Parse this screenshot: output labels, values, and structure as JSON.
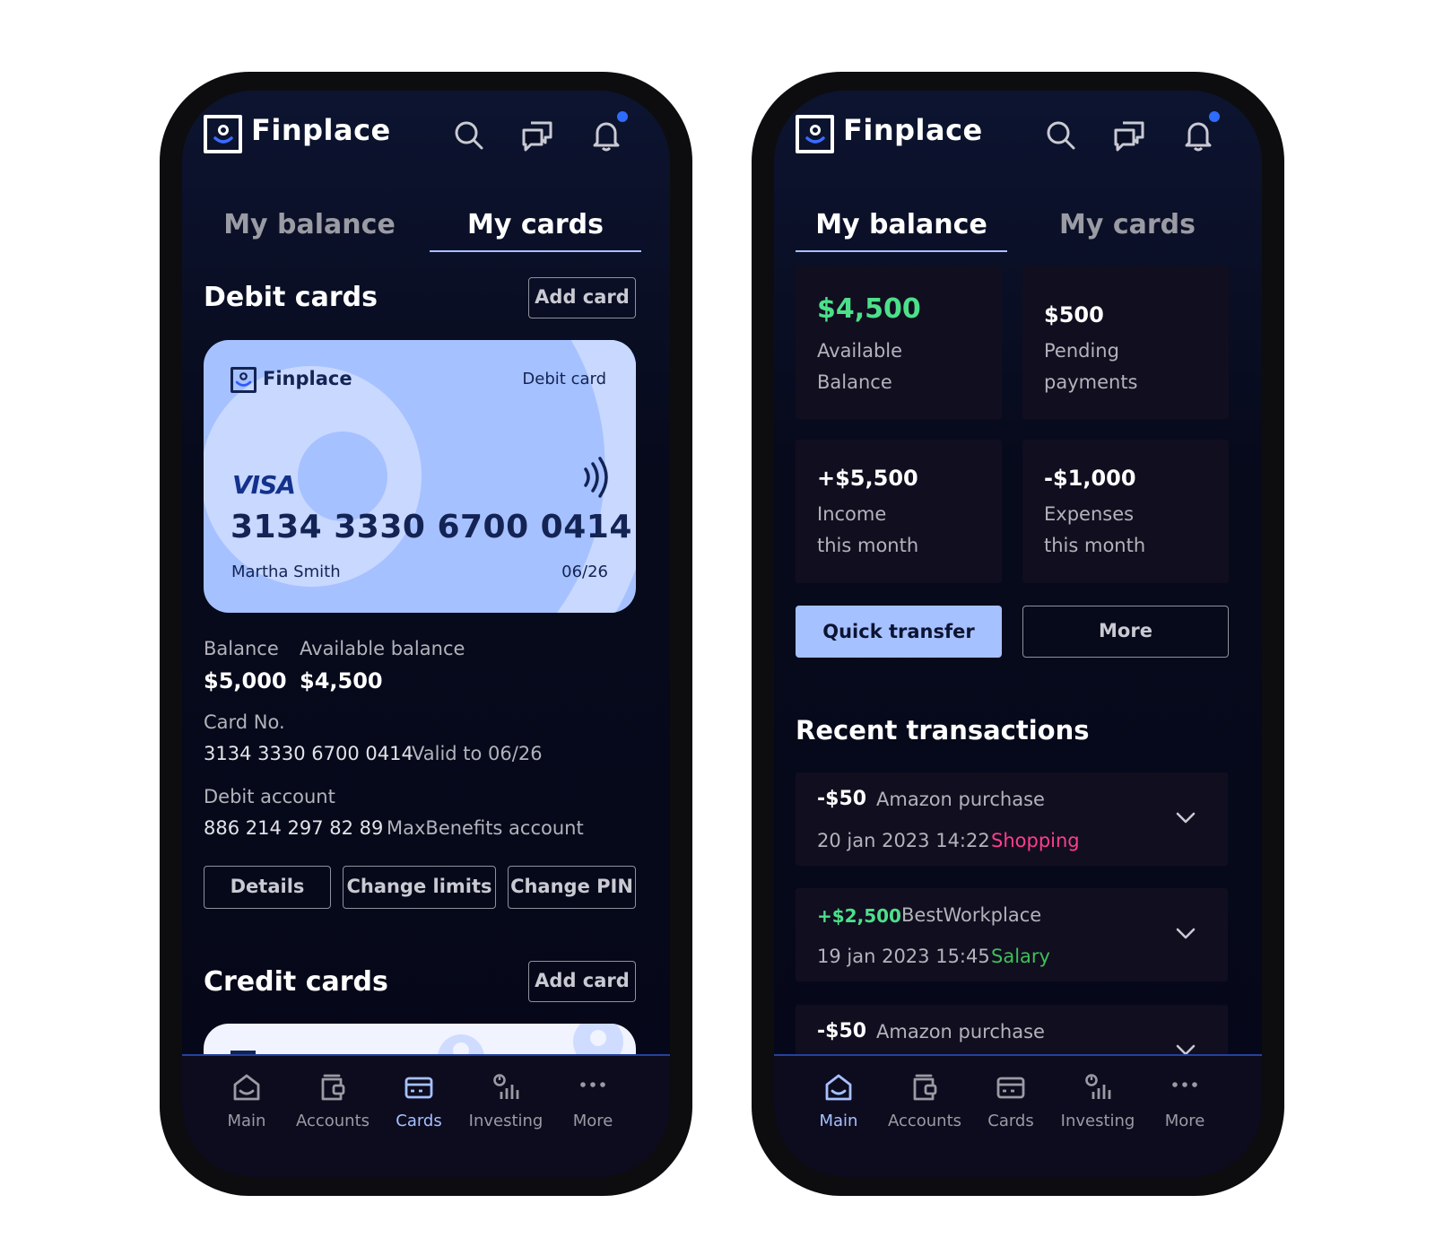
{
  "colors": {
    "accent": "#a6c1ff",
    "positive": "#4ce08a",
    "shopping": "#ff3d8f",
    "salary": "#3fbf5a",
    "notification_dot": "#2f6bff"
  },
  "left_phone": {
    "header": {
      "app_name": "Finplace",
      "icons": [
        "search-icon",
        "chat-icon",
        "bell-icon"
      ]
    },
    "tabs": [
      {
        "label": "My balance",
        "active": false
      },
      {
        "label": "My cards",
        "active": true
      }
    ],
    "debit": {
      "title": "Debit cards",
      "add_label": "Add card",
      "card": {
        "brand": "Finplace",
        "type": "Debit card",
        "network": "VISA",
        "number": "3134 3330 6700 0414",
        "holder": "Martha Smith",
        "expiry": "06/26"
      },
      "balance_label": "Balance",
      "balance_value": "$5,000",
      "available_label": "Available balance",
      "available_value": "$4,500",
      "card_no_label": "Card No.",
      "card_no_value": "3134 3330 6700 0414",
      "valid_to": "Valid to 06/26",
      "account_label": "Debit account",
      "account_number": "886 214 297 82 89",
      "account_name": "MaxBenefits account",
      "actions": [
        "Details",
        "Change limits",
        "Change PIN"
      ]
    },
    "credit": {
      "title": "Credit cards",
      "add_label": "Add card"
    },
    "nav": [
      {
        "label": "Main",
        "icon": "home-icon",
        "active": false
      },
      {
        "label": "Accounts",
        "icon": "wallet-icon",
        "active": false
      },
      {
        "label": "Cards",
        "icon": "card-icon",
        "active": true
      },
      {
        "label": "Investing",
        "icon": "investing-icon",
        "active": false
      },
      {
        "label": "More",
        "icon": "more-icon",
        "active": false
      }
    ]
  },
  "right_phone": {
    "header": {
      "app_name": "Finplace",
      "icons": [
        "search-icon",
        "chat-icon",
        "bell-icon"
      ]
    },
    "tabs": [
      {
        "label": "My balance",
        "active": true
      },
      {
        "label": "My cards",
        "active": false
      }
    ],
    "tiles": [
      {
        "amount": "$4,500",
        "line1": "Available",
        "line2": "Balance",
        "amount_color": "#4ce08a"
      },
      {
        "amount": "$500",
        "line1": "Pending",
        "line2": "payments"
      },
      {
        "amount": "+$5,500",
        "line1": "Income",
        "line2": "this month"
      },
      {
        "amount": "-$1,000",
        "line1": "Expenses",
        "line2": "this month"
      }
    ],
    "quick_transfer_label": "Quick transfer",
    "more_label": "More",
    "recent_title": "Recent transactions",
    "transactions": [
      {
        "amount": "-$50",
        "description": "Amazon purchase",
        "datetime": "20 jan 2023 14:22",
        "category": "Shopping",
        "category_color": "#ff3d8f"
      },
      {
        "amount": "+$2,500",
        "description": "BestWorkplace",
        "datetime": "19 jan 2023 15:45",
        "category": "Salary",
        "category_color": "#3fbf5a"
      },
      {
        "amount": "-$50",
        "description": "Amazon purchase"
      }
    ],
    "nav": [
      {
        "label": "Main",
        "icon": "home-icon",
        "active": true
      },
      {
        "label": "Accounts",
        "icon": "wallet-icon",
        "active": false
      },
      {
        "label": "Cards",
        "icon": "card-icon",
        "active": false
      },
      {
        "label": "Investing",
        "icon": "investing-icon",
        "active": false
      },
      {
        "label": "More",
        "icon": "more-icon",
        "active": false
      }
    ]
  }
}
